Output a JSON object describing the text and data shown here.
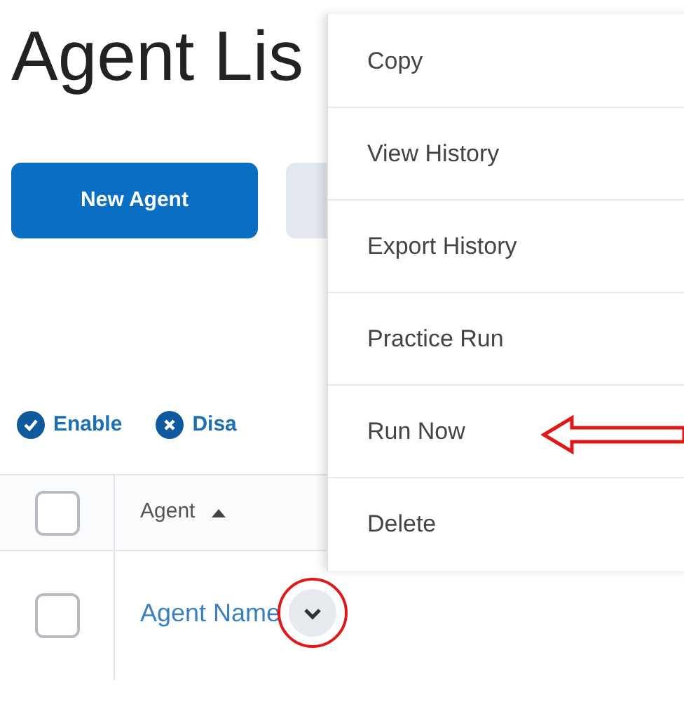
{
  "page": {
    "title": "Agent Lis"
  },
  "toolbar": {
    "primary_button": "New Agent"
  },
  "actions": [
    {
      "label": "Enable",
      "kind": "enable"
    },
    {
      "label": "Disa",
      "kind": "disable"
    }
  ],
  "table": {
    "header": {
      "label": "Agent",
      "sorted_ascending": true,
      "checked": false
    },
    "rows": [
      {
        "name": "Agent Name",
        "checked": false,
        "menu_circled": true
      }
    ]
  },
  "menu": {
    "items": [
      {
        "label": "Copy",
        "pointed": false
      },
      {
        "label": "View History",
        "pointed": false
      },
      {
        "label": "Export History",
        "pointed": false
      },
      {
        "label": "Practice Run",
        "pointed": false
      },
      {
        "label": "Run Now",
        "pointed": true
      },
      {
        "label": "Delete",
        "pointed": false
      }
    ]
  }
}
